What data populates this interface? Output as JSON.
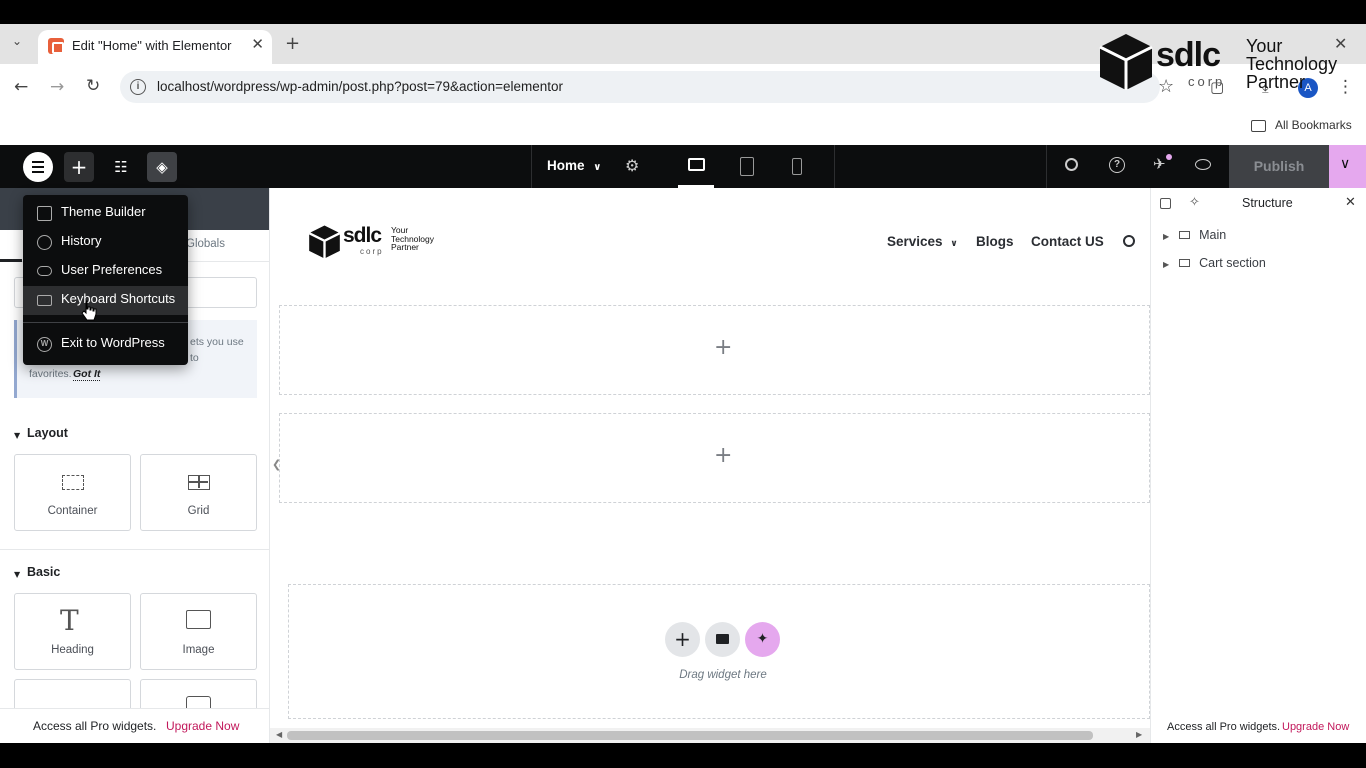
{
  "browser": {
    "tab_title": "Edit \"Home\" with Elementor",
    "url": "localhost/wordpress/wp-admin/post.php?post=79&action=elementor",
    "bookmarks_label": "All Bookmarks",
    "profile_initial": "A"
  },
  "watermark": {
    "brand": "sdlc",
    "sub": "corp",
    "line1": "Your",
    "line2": "Technology",
    "line3": "Partner"
  },
  "topbar": {
    "page_name": "Home",
    "publish_label": "Publish"
  },
  "app_menu": {
    "items": [
      {
        "label": "Theme Builder",
        "icon": "theme-builder-icon"
      },
      {
        "label": "History",
        "icon": "history-icon"
      },
      {
        "label": "User Preferences",
        "icon": "toggle-icon"
      },
      {
        "label": "Keyboard Shortcuts",
        "icon": "keyboard-icon"
      },
      {
        "label": "Exit to WordPress",
        "icon": "wordpress-icon"
      }
    ]
  },
  "left_panel": {
    "tab_globals": "Globals",
    "notice_line1": "ets you use",
    "notice_line2": "to",
    "notice_line3": "favorites.",
    "notice_got_it": "Got It",
    "sections": {
      "layout": "Layout",
      "basic": "Basic"
    },
    "layout_widgets": [
      "Container",
      "Grid"
    ],
    "basic_widgets": [
      "Heading",
      "Image"
    ],
    "footer_text": "Access all Pro widgets.",
    "footer_link": "Upgrade Now"
  },
  "canvas": {
    "logo_brand": "sdlc",
    "logo_sub": "corp",
    "logo_tag1": "Your",
    "logo_tag2": "Technology",
    "logo_tag3": "Partner",
    "nav": [
      "Services",
      "Blogs",
      "Contact US"
    ],
    "drag_hint": "Drag widget here"
  },
  "structure_panel": {
    "title": "Structure",
    "items": [
      "Main",
      "Cart section"
    ],
    "footer_text": "Access all Pro widgets.",
    "footer_link": "Upgrade Now"
  },
  "colors": {
    "accent_pink": "#e5a8ee",
    "upgrade_link": "#c2185b",
    "topbar_bg": "#0c0d0e"
  }
}
